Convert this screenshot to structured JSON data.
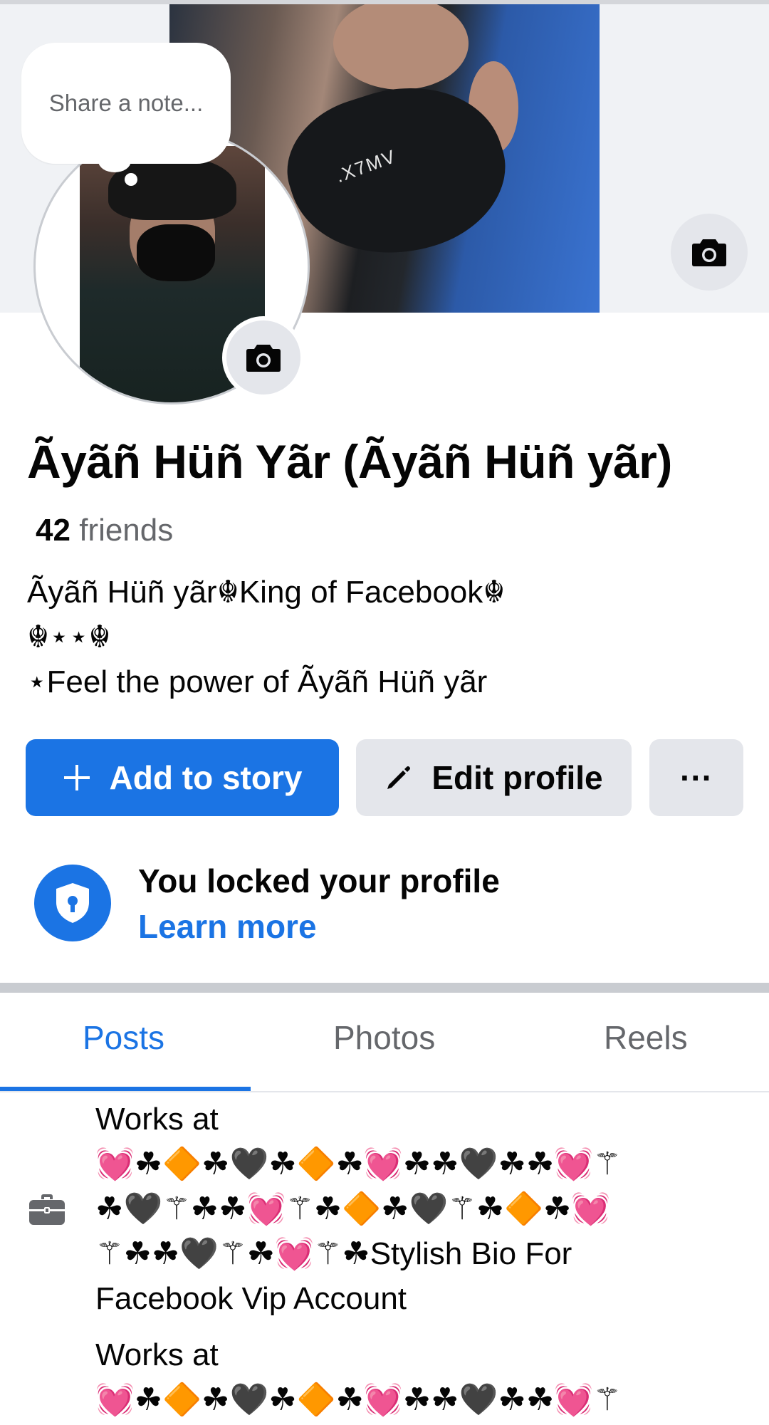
{
  "note": {
    "placeholder": "Share a note..."
  },
  "cover": {
    "mask_text": ".X7MV"
  },
  "profile": {
    "name": "Ãyãñ Hüñ Yãr (Ãyãñ Hüñ yãr)",
    "friends_count": "42",
    "friends_label": "friends",
    "bio_lines": [
      "Ãyãñ Hüñ yãr☬King of Facebook☬",
      "☬⋆⋆☬",
      "⋆Feel the power of Ãyãñ Hüñ yãr"
    ]
  },
  "actions": {
    "add_story": "Add to story",
    "edit_profile": "Edit profile",
    "more": "···"
  },
  "lock": {
    "title": "You locked your profile",
    "link": "Learn more"
  },
  "tabs": [
    {
      "label": "Posts",
      "active": true
    },
    {
      "label": "Photos",
      "active": false
    },
    {
      "label": "Reels",
      "active": false
    }
  ],
  "work": {
    "entries": [
      {
        "lines": [
          "Works at",
          "💓☘🔶☘🖤☘🔶☘💓☘☘🖤☘☘💓⚚",
          "☘🖤⚚☘☘💓⚚☘🔶☘🖤⚚☘🔶☘💓",
          "⚚☘☘🖤⚚☘💓⚚☘Stylish Bio For",
          "Facebook Vip Account"
        ]
      },
      {
        "lines": [
          "Works at",
          "💓☘🔶☘🖤☘🔶☘💓☘☘🖤☘☘💓⚚"
        ]
      }
    ]
  },
  "colors": {
    "accent": "#1b74e4",
    "button_grey": "#e4e6eb",
    "secondary_text": "#65676b"
  },
  "icons": [
    "camera-icon",
    "plus-icon",
    "pencil-icon",
    "more-icon",
    "shield-lock-icon",
    "briefcase-icon"
  ]
}
